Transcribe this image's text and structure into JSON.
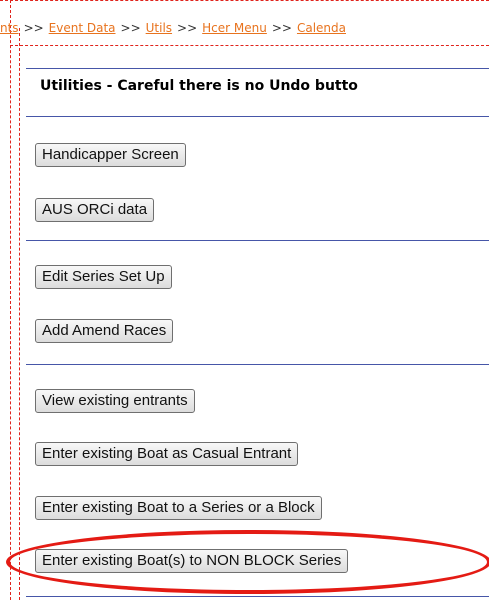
{
  "breadcrumb": {
    "items": [
      "nts",
      "Event Data",
      "Utils",
      "Hcer Menu",
      "Calenda"
    ],
    "separator": ">>"
  },
  "panel": {
    "title": "Utilities - Careful there is no Undo butto"
  },
  "buttons": {
    "handicapper_screen": "Handicapper Screen",
    "aus_orci_data": "AUS ORCi data",
    "edit_series_setup": "Edit Series Set Up",
    "add_amend_races": "Add Amend Races",
    "view_existing_entrants": "View existing entrants",
    "enter_casual_entrant": "Enter existing Boat as Casual Entrant",
    "enter_series_or_block": "Enter existing Boat to a Series or a Block",
    "enter_non_block_series": "Enter existing Boat(s) to NON BLOCK Series"
  },
  "colors": {
    "link": "#e8731e",
    "frame_dash": "#e0231c",
    "divider": "#4656a8",
    "highlight": "#e41b14"
  }
}
